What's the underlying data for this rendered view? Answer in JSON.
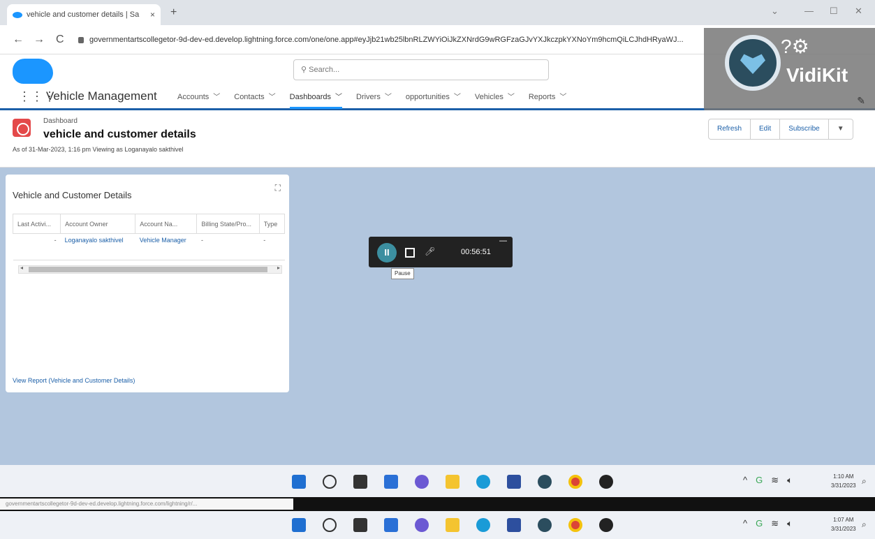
{
  "browser": {
    "tab_title": "vehicle and customer details | Sa",
    "tab_close": "×",
    "new_tab": "+",
    "url": "governmentartscollegetor-9d-dev-ed.develop.lightning.force.com/one/one.app#eyJjb21wb25lbnRLZWYiOiJkZXNrdG9wRGFzaGJvYXJkczpkYXNoYm9hcmQiLCJhdHRyaWJ...",
    "back": "←",
    "forward": "→",
    "reload": "C"
  },
  "sf": {
    "search_placeholder": "Search...",
    "app_name": "Vehicle Management",
    "nav": [
      {
        "label": "Accounts"
      },
      {
        "label": "Contacts"
      },
      {
        "label": "Dashboards"
      },
      {
        "label": "Drivers"
      },
      {
        "label": "opportunities"
      },
      {
        "label": "Vehicles"
      },
      {
        "label": "Reports"
      }
    ],
    "active_nav": "Dashboards"
  },
  "vidikit": {
    "brand": "VidiKit"
  },
  "dashboard": {
    "object_label": "Dashboard",
    "title": "vehicle and customer details",
    "meta": "As of 31-Mar-2023, 1:16 pm Viewing as Loganayalo sakthivel",
    "buttons": {
      "refresh": "Refresh",
      "edit": "Edit",
      "subscribe": "Subscribe",
      "more": "▼"
    }
  },
  "component": {
    "title": "Vehicle and Customer Details",
    "expand": "⛶",
    "columns": [
      "Last Activi...",
      "Account Owner",
      "Account Na...",
      "Billing State/Pro...",
      "Type"
    ],
    "rows": [
      [
        "-",
        "Loganayalo sakthivel",
        "Vehicle Manager",
        "-",
        "-"
      ]
    ],
    "view_report": "View Report (Vehicle and Customer Details)"
  },
  "recorder": {
    "time": "00:56:51",
    "tooltip": "Pause",
    "minimize": "—"
  },
  "taskbar1": {
    "time": "1:10 AM",
    "date": "3/31/2023"
  },
  "taskbar2": {
    "time": "1:07 AM",
    "date": "3/31/2023"
  },
  "status_url": "governmentartscollegetor-9d-dev-ed.develop.lightning.force.com/lightning/r/..."
}
